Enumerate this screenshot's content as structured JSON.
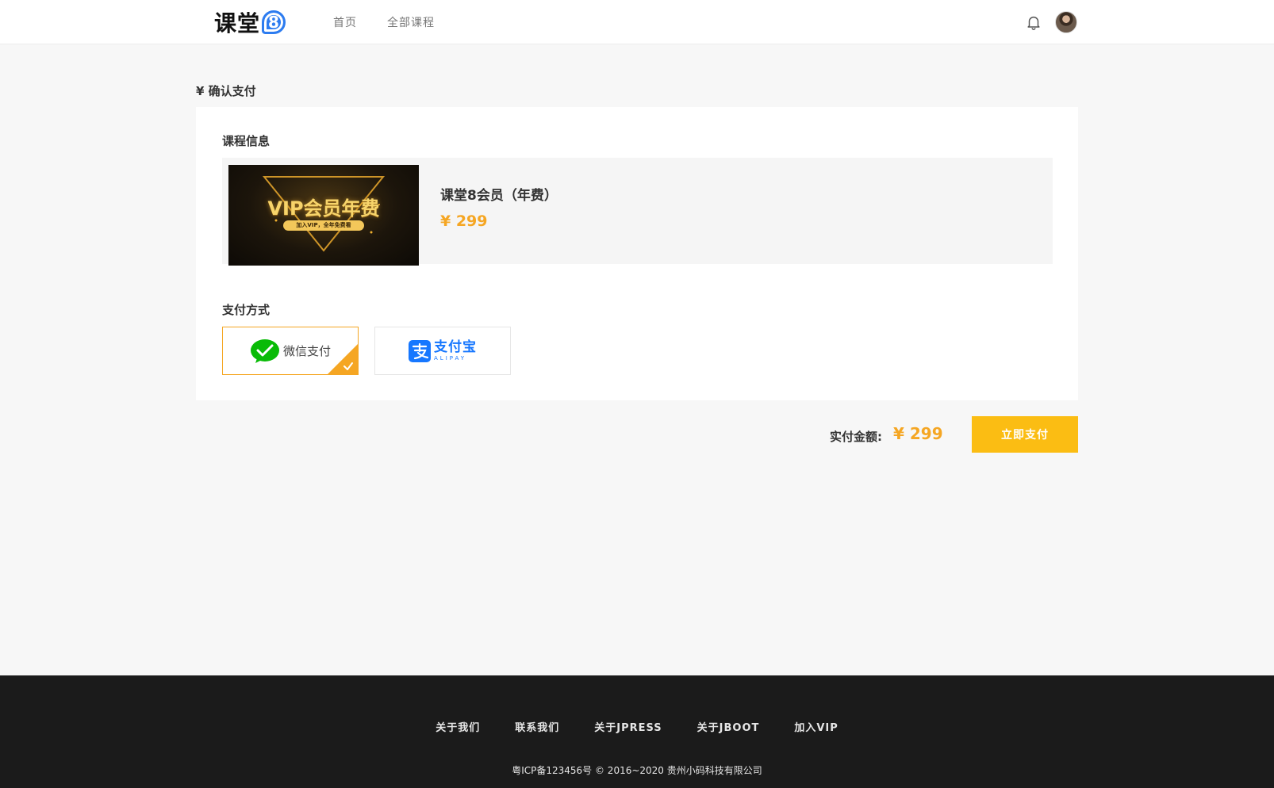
{
  "header": {
    "logo_text": "课堂",
    "logo_badge": "8",
    "nav": [
      {
        "label": "首页"
      },
      {
        "label": "全部课程"
      }
    ]
  },
  "page_title": "¥ 确认支付",
  "course_section": {
    "label": "课程信息",
    "course": {
      "thumb_title": "VIP会员年费",
      "thumb_subtitle": "加入VIP，全年免费看",
      "name": "课堂8会员（年费）",
      "price": "¥ 299"
    }
  },
  "payment_section": {
    "label": "支付方式",
    "options": [
      {
        "label": "微信支付",
        "selected": true
      },
      {
        "label": "支付宝",
        "sublabel": "ALIPAY",
        "selected": false
      }
    ]
  },
  "summary": {
    "total_label": "实付金额:",
    "total_value": "¥ 299",
    "pay_button": "立即支付"
  },
  "footer": {
    "links": [
      {
        "label": "关于我们"
      },
      {
        "label": "联系我们"
      },
      {
        "label": "关于JPRESS"
      },
      {
        "label": "关于JBOOT"
      },
      {
        "label": "加入VIP"
      }
    ],
    "copyright": "粤ICP备123456号 © 2016~2020 贵州小码科技有限公司"
  },
  "colors": {
    "accent": "#f5a623",
    "button": "#fbbd13",
    "brand_blue": "#2d7cf0",
    "wechat_green": "#09bb07",
    "alipay_blue": "#1677ff",
    "footer_bg": "#1b1b1b"
  }
}
